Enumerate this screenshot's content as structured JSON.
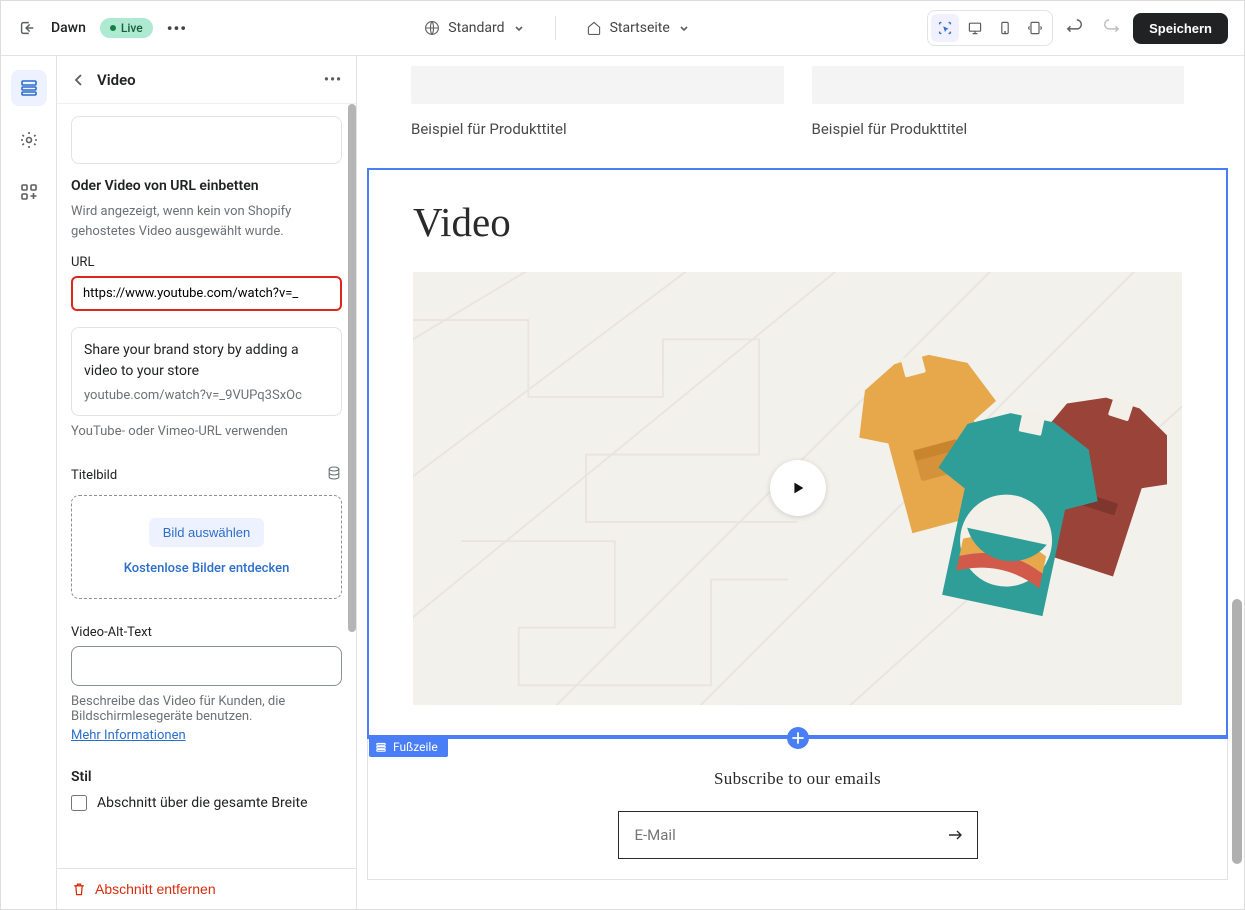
{
  "topbar": {
    "theme_name": "Dawn",
    "live_label": "Live",
    "standard_label": "Standard",
    "home_label": "Startseite",
    "save_label": "Speichern"
  },
  "panel": {
    "title": "Video",
    "embed_heading": "Oder Video von URL einbetten",
    "embed_help": "Wird angezeigt, wenn kein von Shopify gehostetes Video ausgewählt wurde.",
    "url_label": "URL",
    "url_value": "https://www.youtube.com/watch?v=_",
    "preview_title": "Share your brand story by adding a video to your store",
    "preview_sub": "youtube.com/watch?v=_9VUPq3SxOc",
    "url_help": "YouTube- oder Vimeo-URL verwenden",
    "cover_label": "Titelbild",
    "pick_image_label": "Bild auswählen",
    "discover_label": "Kostenlose Bilder entdecken",
    "alt_label": "Video-Alt-Text",
    "alt_help": "Beschreibe das Video für Kunden, die Bildschirmlesegeräte benutzen.",
    "more_info": "Mehr Informationen",
    "style_heading": "Stil",
    "fullwidth_label": "Abschnitt über die gesamte Breite",
    "remove_label": "Abschnitt entfernen"
  },
  "preview": {
    "product_title": "Beispiel für Produkttitel",
    "video_heading": "Video",
    "footer_tag": "Fußzeile",
    "subscribe_heading": "Subscribe to our emails",
    "email_placeholder": "E-Mail"
  }
}
